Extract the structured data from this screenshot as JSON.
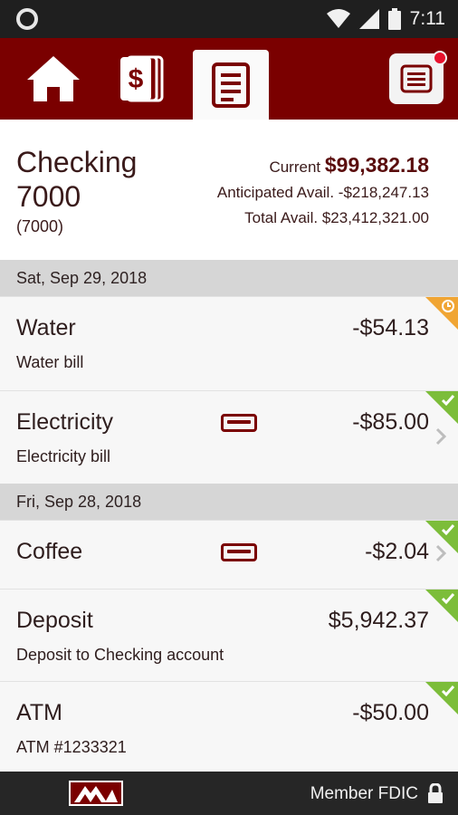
{
  "status_bar": {
    "time": "7:11"
  },
  "nav": {
    "home_icon": "home-icon",
    "accounts_icon": "dollar-cards-icon",
    "transactions_icon": "document-list-icon",
    "menu_icon": "menu-icon"
  },
  "account": {
    "name_line1": "Checking",
    "name_line2": "7000",
    "number": "(7000)",
    "current_label": "Current",
    "current_amount": "$99,382.18",
    "anticipated_label": "Anticipated Avail.",
    "anticipated_amount": "-$218,247.13",
    "total_label": "Total Avail.",
    "total_amount": "$23,412,321.00"
  },
  "groups": [
    {
      "date": "Sat, Sep 29, 2018",
      "transactions": [
        {
          "title": "Water",
          "subtitle": "Water bill",
          "amount": "-$54.13",
          "status": "pending"
        },
        {
          "title": "Electricity",
          "subtitle": "Electricity bill",
          "amount": "-$85.00",
          "status": "cleared"
        }
      ]
    },
    {
      "date": "Fri, Sep 28, 2018",
      "transactions": [
        {
          "title": "Coffee",
          "subtitle": "",
          "amount": "-$2.04",
          "status": "cleared"
        },
        {
          "title": "Deposit",
          "subtitle": "Deposit to Checking account",
          "amount": "$5,942.37",
          "status": "cleared"
        },
        {
          "title": "ATM",
          "subtitle": "ATM #1233321",
          "amount": "-$50.00",
          "status": "cleared"
        }
      ]
    }
  ],
  "footer": {
    "member_text": "Member FDIC"
  },
  "colors": {
    "brand": "#7a0000",
    "cleared": "#7cbd3a",
    "pending": "#f0a534"
  }
}
